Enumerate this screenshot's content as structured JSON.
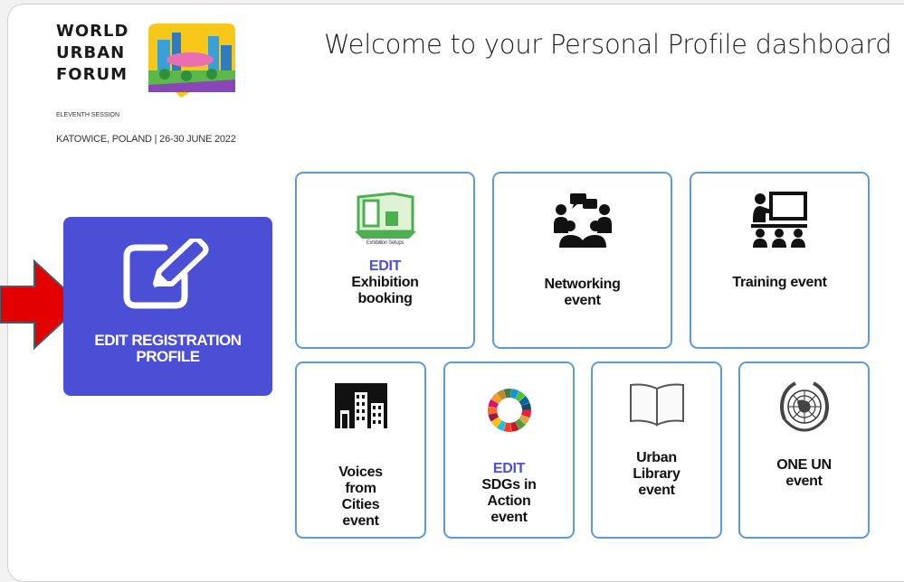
{
  "logo": {
    "line1": "WORLD",
    "line2": "URBAN",
    "line3": "FORUM",
    "session": "ELEVENTH SESSION",
    "place": "KATOWICE, POLAND | 26-30 JUNE 2022"
  },
  "header": {
    "title": "Welcome to your Personal Profile dashboard"
  },
  "primary": {
    "line1": "EDIT REGISTRATION",
    "line2": "PROFILE"
  },
  "cards": {
    "exhibition": {
      "icon_caption": "Exhibition Setups",
      "edit": "EDIT",
      "line1": "Exhibition",
      "line2": "booking"
    },
    "networking": {
      "line1": "Networking",
      "line2": "event"
    },
    "training": {
      "line1": "Training event"
    },
    "voices": {
      "line1": "Voices",
      "line2": "from",
      "line3": "Cities",
      "line4": "event"
    },
    "sdgs": {
      "edit": "EDIT",
      "line1": "SDGs in",
      "line2": "Action",
      "line3": "event"
    },
    "library": {
      "line1": "Urban",
      "line2": "Library",
      "line3": "event"
    },
    "oneun": {
      "line1": "ONE UN",
      "line2": "event"
    }
  },
  "colors": {
    "primary": "#4b4fd6",
    "card_border": "#5b9bd8",
    "arrow": "#e30000"
  }
}
